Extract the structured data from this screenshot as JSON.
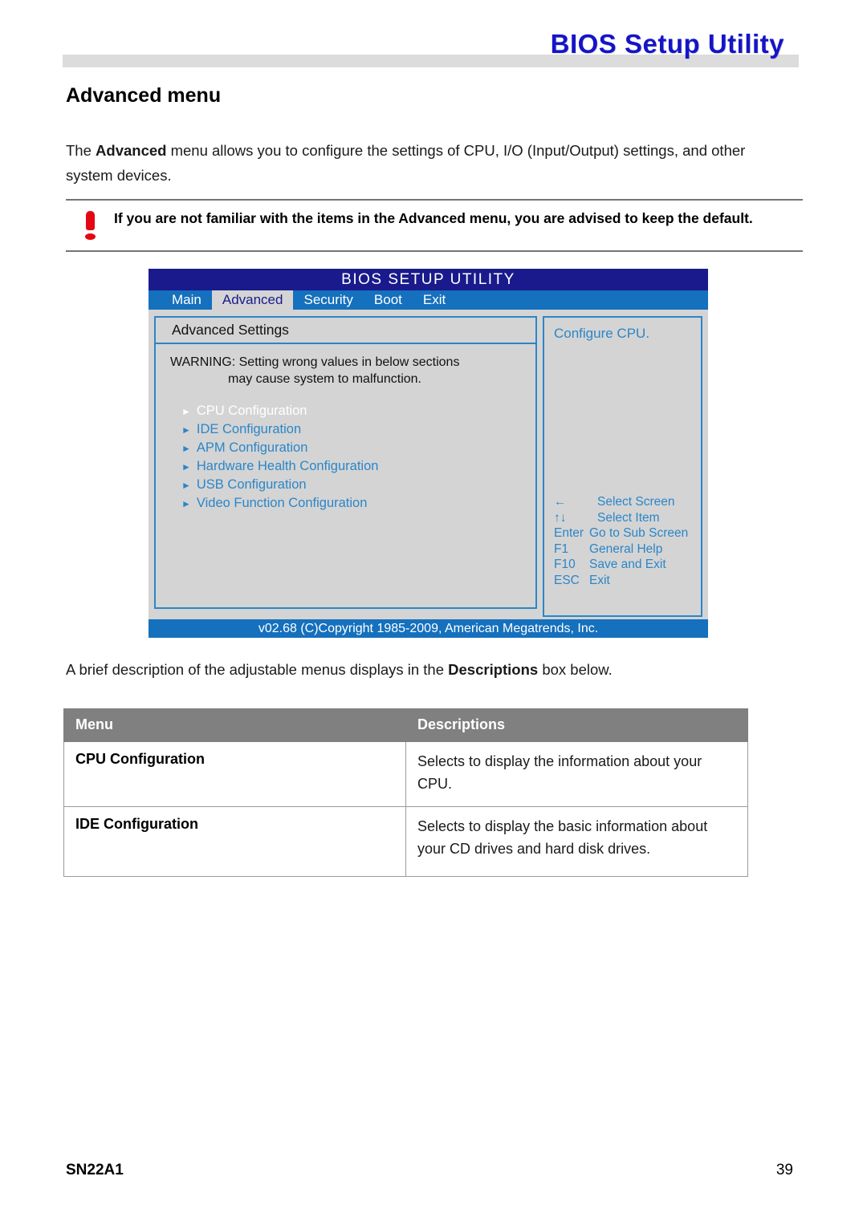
{
  "header": {
    "title": "BIOS Setup Utility"
  },
  "page": {
    "heading": "Advanced menu",
    "intro_prefix": "The ",
    "intro_bold": "Advanced",
    "intro_suffix": " menu allows you to configure the settings of CPU, I/O (Input/Output) settings, and other system devices.",
    "mid_prefix": "A brief description of the adjustable menus displays in the ",
    "mid_bold": "Descriptions",
    "mid_suffix": " box below."
  },
  "note": {
    "icon": "exclamation-icon",
    "text": "If you are not familiar with the items in the Advanced menu, you are advised to keep the default."
  },
  "bios": {
    "title": "BIOS  SETUP  UTILITY",
    "tabs": [
      {
        "label": "Main",
        "active": false
      },
      {
        "label": "Advanced",
        "active": true
      },
      {
        "label": "Security",
        "active": false
      },
      {
        "label": "Boot",
        "active": false
      },
      {
        "label": "Exit",
        "active": false
      }
    ],
    "panel_header": "Advanced Settings",
    "warning_line1": "WARNING: Setting wrong values in below sections",
    "warning_line2": "may cause system to malfunction.",
    "items": [
      {
        "label": "CPU Configuration",
        "selected": true
      },
      {
        "label": "IDE Configuration",
        "selected": false
      },
      {
        "label": "APM Configuration",
        "selected": false
      },
      {
        "label": "Hardware Health Configuration",
        "selected": false
      },
      {
        "label": "USB Configuration",
        "selected": false
      },
      {
        "label": "Video Function Configuration",
        "selected": false
      }
    ],
    "help_text": "Configure CPU.",
    "keys": [
      {
        "key": "←",
        "desc": "Select Screen"
      },
      {
        "key": "↑↓",
        "desc": "Select Item"
      },
      {
        "key": "Enter",
        "desc": "Go to Sub Screen"
      },
      {
        "key": "F1",
        "desc": "General Help"
      },
      {
        "key": "F10",
        "desc": "Save and Exit"
      },
      {
        "key": "ESC",
        "desc": "Exit"
      }
    ],
    "footer": "v02.68 (C)Copyright 1985-2009, American Megatrends, Inc."
  },
  "table": {
    "headers": [
      "Menu",
      "Descriptions"
    ],
    "rows": [
      {
        "menu": "CPU Configuration",
        "description": "Selects to display the information about your CPU."
      },
      {
        "menu": "IDE Configuration",
        "description": "Selects to display the basic information about your CD drives and hard disk drives."
      }
    ]
  },
  "footer": {
    "left": "SN22A1",
    "right": "39"
  },
  "colors": {
    "title_blue": "#1414c8",
    "bios_titlebar": "#1a1a8c",
    "bios_menubar": "#1570bd",
    "bios_accent": "#2b86c8",
    "bios_bg": "#d4d4d4",
    "table_header_gray": "#808080",
    "warning_red": "#e30613",
    "header_bar_gray": "#dcdcdc"
  }
}
